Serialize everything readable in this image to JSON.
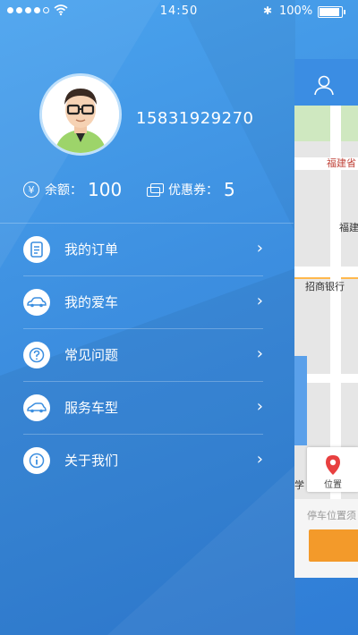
{
  "status_bar": {
    "signal_dots": 5,
    "signal_filled": 4,
    "time": "14:50",
    "bluetooth": "✱",
    "battery_text": "100%",
    "battery_level": 1.0
  },
  "profile": {
    "phone": "15831929270"
  },
  "stats": {
    "balance_label": "余额：",
    "balance_value": "100",
    "coupon_label": "优惠券：",
    "coupon_value": "5"
  },
  "menu": [
    {
      "label": "我的订单",
      "icon": "order-icon"
    },
    {
      "label": "我的爱车",
      "icon": "car-icon"
    },
    {
      "label": "常见问题",
      "icon": "question-icon"
    },
    {
      "label": "服务车型",
      "icon": "car-type-icon"
    },
    {
      "label": "关于我们",
      "icon": "info-icon"
    }
  ],
  "map_panel": {
    "labels": [
      "福建省",
      "福建",
      "招商银行",
      "学"
    ],
    "location_button": "位置",
    "bottom_hint": "停车位置须"
  },
  "colors": {
    "background": "#3d8fe0",
    "accent_orange": "#f39a2a",
    "map_pin": "#e84040"
  }
}
